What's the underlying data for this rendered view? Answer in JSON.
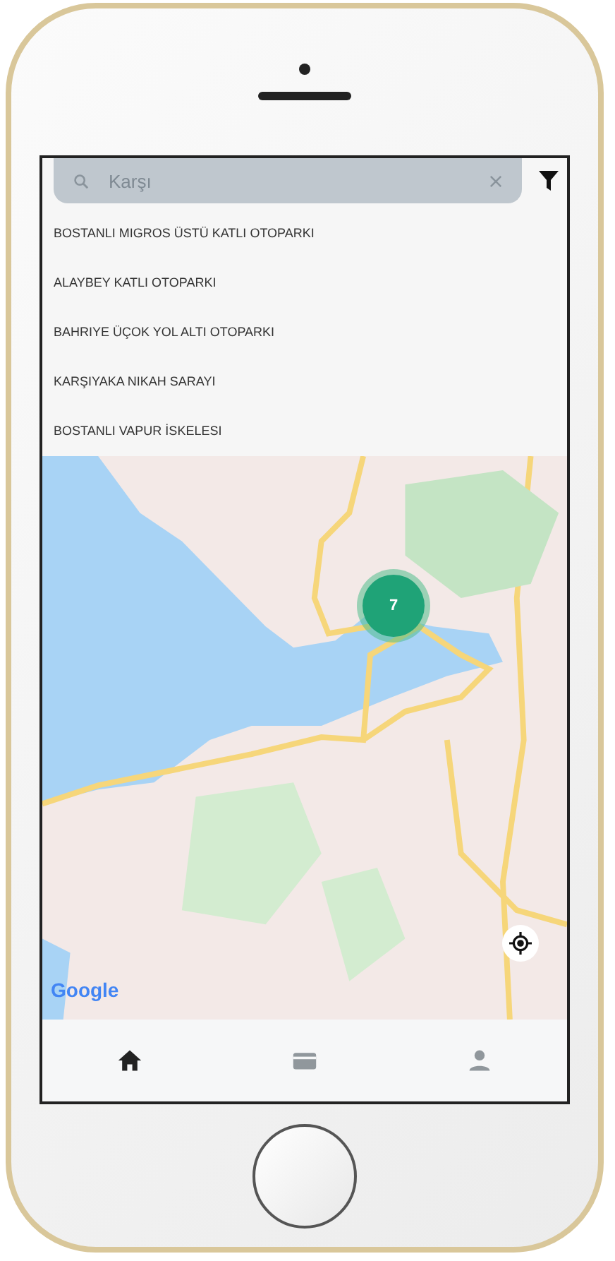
{
  "search": {
    "value": "Karşı"
  },
  "suggestions": [
    {
      "label": "BOSTANLI MIGROS ÜSTÜ KATLI OTOPARKI"
    },
    {
      "label": "ALAYBEY KATLI OTOPARKI"
    },
    {
      "label": "BAHRIYE ÜÇOK YOL ALTI OTOPARKI"
    },
    {
      "label": "KARŞIYAKA NIKAH SARAYI"
    },
    {
      "label": "BOSTANLI VAPUR İSKELESI"
    }
  ],
  "map": {
    "cluster_count": "7",
    "attribution": "Google"
  },
  "nav": [
    {
      "kind": "home",
      "selected": true
    },
    {
      "kind": "card",
      "selected": false
    },
    {
      "kind": "person",
      "selected": false
    }
  ]
}
